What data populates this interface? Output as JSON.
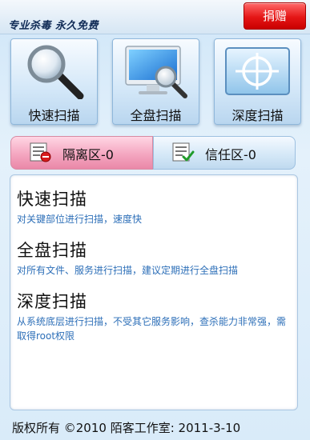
{
  "header": {
    "slogan": "专业杀毒 永久免费",
    "donate_label": "捐赠"
  },
  "scan_buttons": [
    {
      "label": "快速扫描",
      "icon": "magnifier-icon"
    },
    {
      "label": "全盘扫描",
      "icon": "monitor-magnifier-icon"
    },
    {
      "label": "深度扫描",
      "icon": "crosshair-screen-icon"
    }
  ],
  "tabs": [
    {
      "label": "隔离区-0",
      "icon": "quarantine-list-icon",
      "selected": true
    },
    {
      "label": "信任区-0",
      "icon": "trust-list-icon",
      "selected": false
    }
  ],
  "descriptions": [
    {
      "title": "快速扫描",
      "text": "对关键部位进行扫描，速度快"
    },
    {
      "title": "全盘扫描",
      "text": "对所有文件、服务进行扫描，建议定期进行全盘扫描"
    },
    {
      "title": "深度扫描",
      "text": "从系统底层进行扫描，不受其它服务影响，查杀能力非常强，需取得root权限"
    }
  ],
  "footer": {
    "copyright": "版权所有 ©2010 陌客工作室: 2011-3-10"
  },
  "colors": {
    "donate": "#e51616",
    "selected_tab": "#f4a6c0",
    "description_text": "#2d6fb8"
  }
}
